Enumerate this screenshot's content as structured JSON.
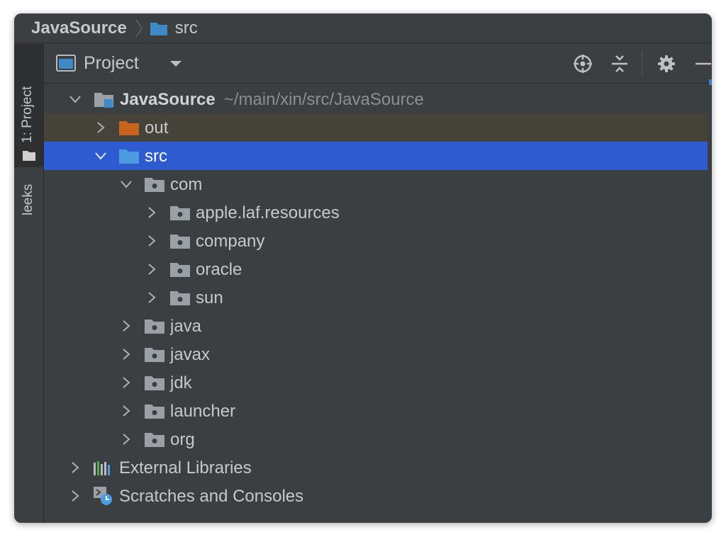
{
  "breadcrumb": {
    "root": "JavaSource",
    "current": "src"
  },
  "tool_strip": {
    "project_tab": "1: Project",
    "leeks_tab": "leeks"
  },
  "panel": {
    "title": "Project",
    "buttons": [
      "locate-icon",
      "collapse-all-icon",
      "gear-icon",
      "minimize-icon"
    ]
  },
  "tree": {
    "root": {
      "name": "JavaSource",
      "path": "~/main/xin/src/JavaSource"
    },
    "out": "out",
    "src": "src",
    "com": "com",
    "com_children": [
      "apple.laf.resources",
      "company",
      "oracle",
      "sun"
    ],
    "src_children": [
      "java",
      "javax",
      "jdk",
      "launcher",
      "org"
    ],
    "external_libraries": "External Libraries",
    "scratches": "Scratches and Consoles"
  },
  "colors": {
    "background": "#3c3f41",
    "selection": "#2f5bd0",
    "excluded_row": "#45433a",
    "source_folder": "#3d8ac7",
    "excluded_folder": "#c8641e",
    "package_folder": "#9aa0a6"
  }
}
